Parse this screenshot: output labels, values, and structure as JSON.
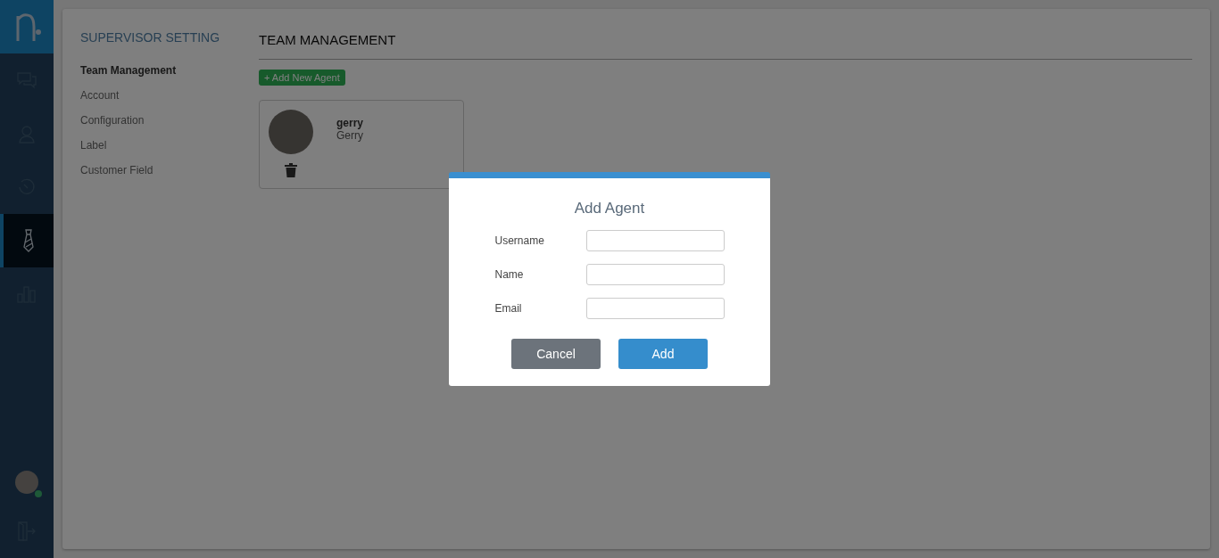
{
  "rail": {
    "items": [
      {
        "kind": "chat",
        "selected": false
      },
      {
        "kind": "agent",
        "selected": false
      },
      {
        "kind": "history",
        "selected": false
      },
      {
        "kind": "tie",
        "selected": true
      },
      {
        "kind": "chart",
        "selected": false
      }
    ],
    "user": {
      "online": true
    }
  },
  "settings_nav": {
    "title": "SUPERVISOR SETTING",
    "items": [
      {
        "label": "Team Management",
        "selected": true
      },
      {
        "label": "Account",
        "selected": false
      },
      {
        "label": "Configuration",
        "selected": false
      },
      {
        "label": "Label",
        "selected": false
      },
      {
        "label": "Customer Field",
        "selected": false
      }
    ]
  },
  "page": {
    "title": "TEAM MANAGEMENT",
    "add_button": "+ Add New Agent"
  },
  "agents": [
    {
      "username": "gerry",
      "name": "Gerry"
    }
  ],
  "dialog": {
    "title": "Add Agent",
    "fields": [
      {
        "label": "Username"
      },
      {
        "label": "Name"
      },
      {
        "label": "Email"
      }
    ],
    "buttons": [
      {
        "label": "Cancel",
        "kind": "secondary"
      },
      {
        "label": "Add",
        "kind": "primary"
      }
    ]
  }
}
